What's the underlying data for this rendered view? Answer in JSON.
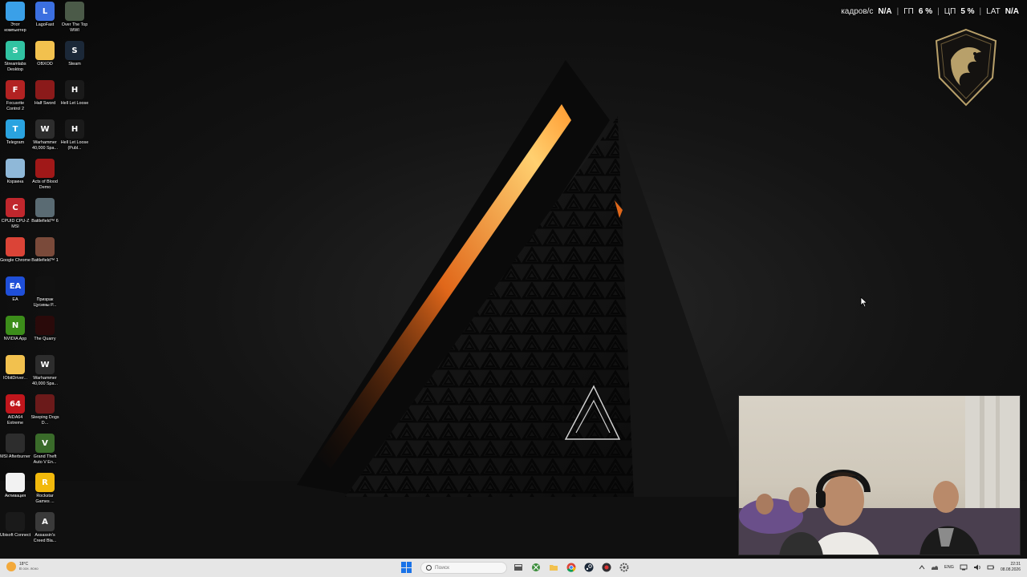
{
  "desktop_icons": [
    {
      "label": "Этот компьютер",
      "icon": "computer-icon",
      "color": "#3aa0e8",
      "glyph": ""
    },
    {
      "label": "LagoFast",
      "icon": "lagofast-icon",
      "color": "#3b6fe0",
      "glyph": "L"
    },
    {
      "label": "Over The Top WWI",
      "icon": "game-otwwi-icon",
      "color": "#4b5a48",
      "glyph": ""
    },
    {
      "label": "Streamlabs Desktop",
      "icon": "streamlabs-icon",
      "color": "#31c3a2",
      "glyph": "S"
    },
    {
      "label": "OBXOD",
      "icon": "folder-icon",
      "color": "#f2c14e",
      "glyph": ""
    },
    {
      "label": "Steam",
      "icon": "steam-icon",
      "color": "#1b2838",
      "glyph": "S"
    },
    {
      "label": "Focusrite Control 2",
      "icon": "focusrite-icon",
      "color": "#b22222",
      "glyph": "F"
    },
    {
      "label": "Half Sword",
      "icon": "half-sword-icon",
      "color": "#8b1a1a",
      "glyph": ""
    },
    {
      "label": "Hell Let Loose",
      "icon": "hell-let-loose-icon",
      "color": "#1a1a1a",
      "glyph": "H"
    },
    {
      "label": "Telegram",
      "icon": "telegram-icon",
      "color": "#2aa3e0",
      "glyph": "T"
    },
    {
      "label": "Warhammer 40,000 Spa...",
      "icon": "warhammer-icon",
      "color": "#2d2d2d",
      "glyph": "W"
    },
    {
      "label": "Hell Let Loose (Publ...",
      "icon": "hell-let-loose-public-icon",
      "color": "#1a1a1a",
      "glyph": "H"
    },
    {
      "label": "Корзина",
      "icon": "recycle-bin-icon",
      "color": "#8fb8d8",
      "glyph": ""
    },
    {
      "label": "Acts of Blood Demo",
      "icon": "acts-of-blood-icon",
      "color": "#a01818",
      "glyph": ""
    },
    {
      "label": "CPUID CPU-Z MSI",
      "icon": "cpuz-icon",
      "color": "#c0272d",
      "glyph": "C"
    },
    {
      "label": "Battlefield™ 6",
      "icon": "battlefield6-icon",
      "color": "#5a6b73",
      "glyph": ""
    },
    {
      "label": "Google Chrome",
      "icon": "chrome-icon",
      "color": "#db4437",
      "glyph": ""
    },
    {
      "label": "Battlefield™ 1",
      "icon": "battlefield1-icon",
      "color": "#7a4a3a",
      "glyph": ""
    },
    {
      "label": "EA",
      "icon": "ea-icon",
      "color": "#1f4fd8",
      "glyph": "EA"
    },
    {
      "label": "Призрак Цусимы Р...",
      "icon": "tsushima-icon",
      "color": "#111111",
      "glyph": ""
    },
    {
      "label": "NVIDIA App",
      "icon": "nvidia-icon",
      "color": "#3c8d1a",
      "glyph": "N"
    },
    {
      "label": "The Quarry",
      "icon": "the-quarry-icon",
      "color": "#2a0a0a",
      "glyph": ""
    },
    {
      "label": "IObitDriver...",
      "icon": "folder-icon",
      "color": "#f2c14e",
      "glyph": ""
    },
    {
      "label": "Warhammer 40,000 Spa...",
      "icon": "warhammer-icon",
      "color": "#2d2d2d",
      "glyph": "W"
    },
    {
      "label": "AIDA64 Extreme",
      "icon": "aida64-icon",
      "color": "#c0161c",
      "glyph": "64"
    },
    {
      "label": "Sleeping Dogs D...",
      "icon": "sleeping-dogs-icon",
      "color": "#6b1a1a",
      "glyph": ""
    },
    {
      "label": "MSI Afterburner",
      "icon": "afterburner-icon",
      "color": "#2d2d2d",
      "glyph": ""
    },
    {
      "label": "Grand Theft Auto V En...",
      "icon": "gta5-icon",
      "color": "#3a6b2a",
      "glyph": "V"
    },
    {
      "label": "Активация",
      "icon": "document-icon",
      "color": "#f2f2f2",
      "glyph": ""
    },
    {
      "label": "Rockstar Games ...",
      "icon": "rockstar-icon",
      "color": "#f2b90c",
      "glyph": "R"
    },
    {
      "label": "Ubisoft Connect",
      "icon": "ubisoft-icon",
      "color": "#1a1a1a",
      "glyph": ""
    },
    {
      "label": "Assassin's Creed Bla...",
      "icon": "assassins-creed-icon",
      "color": "#3a3a3a",
      "glyph": "A"
    }
  ],
  "overlay": {
    "fps_label": "кадров/с",
    "fps_value": "N/A",
    "gpu_label": "ГП",
    "gpu_value": "6 %",
    "cpu_label": "ЦП",
    "cpu_value": "5 %",
    "lat_label": "LAT",
    "lat_value": "N/A",
    "separator": "|"
  },
  "taskbar": {
    "weather_temp": "18°C",
    "weather_desc": "В осн. ясно",
    "search_placeholder": "Поиск",
    "apps": [
      "file-explorer-icon",
      "xbox-icon",
      "folder-icon",
      "chrome-icon",
      "steam-icon",
      "obs-icon",
      "settings-icon"
    ],
    "language": "ENG",
    "time": "22:31",
    "date": "08.08.2026"
  },
  "colors": {
    "accent_blue": "#1a73e8",
    "wallpaper_orange": "#f08a24"
  }
}
